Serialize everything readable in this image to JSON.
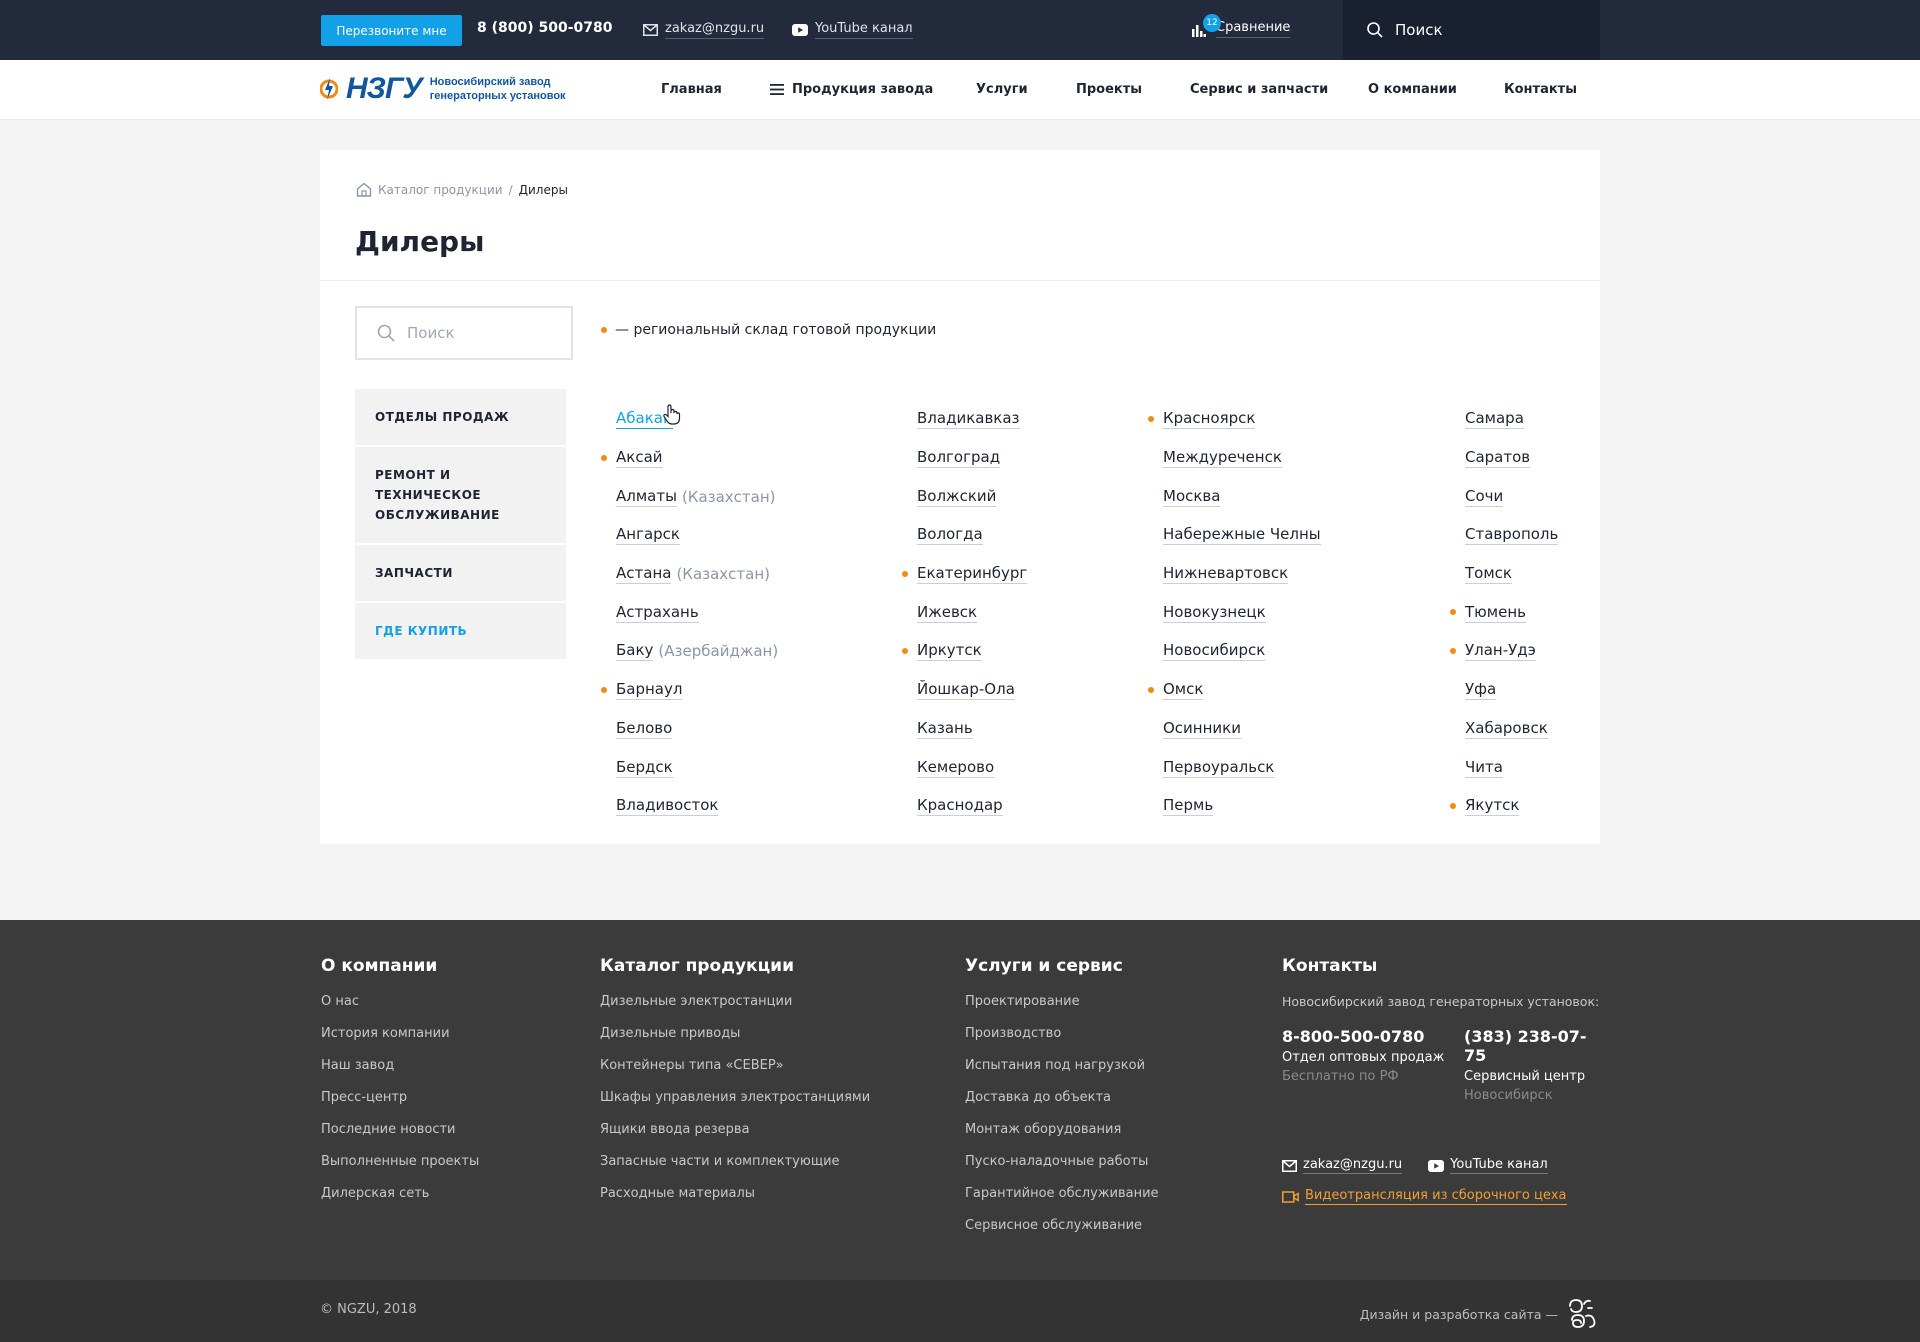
{
  "topbar": {
    "callback_label": "Перезвоните мне",
    "phone": "8 (800) 500-0780",
    "email": "zakaz@nzgu.ru",
    "youtube": "YouTube канал",
    "compare_label": "Сравнение",
    "compare_count": "12",
    "search_placeholder": "Поиск"
  },
  "logo": {
    "mark": "НЗГУ",
    "text": "Новосибирский завод генераторных установок"
  },
  "nav": [
    {
      "label": "Главная"
    },
    {
      "label": "Продукция завода"
    },
    {
      "label": "Услуги"
    },
    {
      "label": "Проекты"
    },
    {
      "label": "Сервис и запчасти"
    },
    {
      "label": "О компании"
    },
    {
      "label": "Контакты"
    }
  ],
  "breadcrumbs": {
    "parent": "Каталог продукции",
    "separator": "/",
    "current": "Дилеры"
  },
  "page_title": "Дилеры",
  "search": {
    "placeholder": "Поиск"
  },
  "legend": "— региональный склад готовой продукции",
  "side_menu": [
    {
      "label": "ОТДЕЛЫ ПРОДАЖ"
    },
    {
      "label": "РЕМОНТ И ТЕХНИЧЕСКОЕ ОБСЛУЖИВАНИЕ"
    },
    {
      "label": "ЗАПЧАСТИ"
    },
    {
      "label": "ГДЕ КУПИТЬ"
    }
  ],
  "cities": [
    [
      {
        "name": "Абакан",
        "country": "",
        "warehouse": false
      },
      {
        "name": "Аксай",
        "country": "",
        "warehouse": true
      },
      {
        "name": "Алматы",
        "country": "(Казахстан)",
        "warehouse": false
      },
      {
        "name": "Ангарск",
        "country": "",
        "warehouse": false
      },
      {
        "name": "Астана",
        "country": "(Казахстан)",
        "warehouse": false
      },
      {
        "name": "Астрахань",
        "country": "",
        "warehouse": false
      },
      {
        "name": "Баку",
        "country": "(Азербайджан)",
        "warehouse": false
      },
      {
        "name": "Барнаул",
        "country": "",
        "warehouse": true
      },
      {
        "name": "Белово",
        "country": "",
        "warehouse": false
      },
      {
        "name": "Бердск",
        "country": "",
        "warehouse": false
      },
      {
        "name": "Владивосток",
        "country": "",
        "warehouse": false
      }
    ],
    [
      {
        "name": "Владикавказ",
        "country": "",
        "warehouse": false
      },
      {
        "name": "Волгоград",
        "country": "",
        "warehouse": false
      },
      {
        "name": "Волжский",
        "country": "",
        "warehouse": false
      },
      {
        "name": "Вологда",
        "country": "",
        "warehouse": false
      },
      {
        "name": "Екатеринбург",
        "country": "",
        "warehouse": true
      },
      {
        "name": "Ижевск",
        "country": "",
        "warehouse": false
      },
      {
        "name": "Иркутск",
        "country": "",
        "warehouse": true
      },
      {
        "name": "Йошкар-Ола",
        "country": "",
        "warehouse": false
      },
      {
        "name": "Казань",
        "country": "",
        "warehouse": false
      },
      {
        "name": "Кемерово",
        "country": "",
        "warehouse": false
      },
      {
        "name": "Краснодар",
        "country": "",
        "warehouse": false
      }
    ],
    [
      {
        "name": "Красноярск",
        "country": "",
        "warehouse": true
      },
      {
        "name": "Междуреченск",
        "country": "",
        "warehouse": false
      },
      {
        "name": "Москва",
        "country": "",
        "warehouse": false
      },
      {
        "name": "Набережные Челны",
        "country": "",
        "warehouse": false
      },
      {
        "name": "Нижневартовск",
        "country": "",
        "warehouse": false
      },
      {
        "name": "Новокузнецк",
        "country": "",
        "warehouse": false
      },
      {
        "name": "Новосибирск",
        "country": "",
        "warehouse": false
      },
      {
        "name": "Омск",
        "country": "",
        "warehouse": true
      },
      {
        "name": "Осинники",
        "country": "",
        "warehouse": false
      },
      {
        "name": "Первоуральск",
        "country": "",
        "warehouse": false
      },
      {
        "name": "Пермь",
        "country": "",
        "warehouse": false
      }
    ],
    [
      {
        "name": "Самара",
        "country": "",
        "warehouse": false
      },
      {
        "name": "Саратов",
        "country": "",
        "warehouse": false
      },
      {
        "name": "Сочи",
        "country": "",
        "warehouse": false
      },
      {
        "name": "Ставрополь",
        "country": "",
        "warehouse": false
      },
      {
        "name": "Томск",
        "country": "",
        "warehouse": false
      },
      {
        "name": "Тюмень",
        "country": "",
        "warehouse": true
      },
      {
        "name": "Улан-Удэ",
        "country": "",
        "warehouse": true
      },
      {
        "name": "Уфа",
        "country": "",
        "warehouse": false
      },
      {
        "name": "Хабаровск",
        "country": "",
        "warehouse": false
      },
      {
        "name": "Чита",
        "country": "",
        "warehouse": false
      },
      {
        "name": "Якутск",
        "country": "",
        "warehouse": true
      }
    ]
  ],
  "footer": {
    "about": {
      "title": "О компании",
      "links": [
        "О нас",
        "История компании",
        "Наш завод",
        "Пресс-центр",
        "Последние новости",
        "Выполненные проекты",
        "Дилерская сеть"
      ]
    },
    "catalog": {
      "title": "Каталог продукции",
      "links": [
        "Дизельные электростанции",
        "Дизельные приводы",
        "Контейнеры типа «СЕВЕР»",
        "Шкафы управления электростанциями",
        "Ящики ввода резерва",
        "Запасные части и комплектующие",
        "Расходные материалы"
      ]
    },
    "services": {
      "title": "Услуги и сервис",
      "links": [
        "Проектирование",
        "Производство",
        "Испытания под нагрузкой",
        "Доставка до объекта",
        "Монтаж оборудования",
        "Пуско-наладочные работы",
        "Гарантийное обслуживание",
        "Сервисное обслуживание"
      ]
    },
    "contacts": {
      "title": "Контакты",
      "company": "Новосибирский завод генераторных установок:",
      "phone1": "8-800-500-0780",
      "phone1_label": "Отдел оптовых продаж",
      "phone1_note": "Бесплатно по РФ",
      "phone2": "(383) 238-07-75",
      "phone2_label": "Сервисный центр",
      "phone2_note": "Новосибирск",
      "email": "zakaz@nzgu.ru",
      "youtube": "YouTube канал",
      "video": "Видеотрансляция из сборочного цеха"
    },
    "copyright": "© NGZU, 2018",
    "dev_credit": "Дизайн и разработка сайта —"
  },
  "colors": {
    "accent": "#12a1e8",
    "dark": "#232a3b",
    "warehouse_dot": "#f28a16",
    "footer": "#3b3b3b",
    "video_link": "#f0a030"
  }
}
